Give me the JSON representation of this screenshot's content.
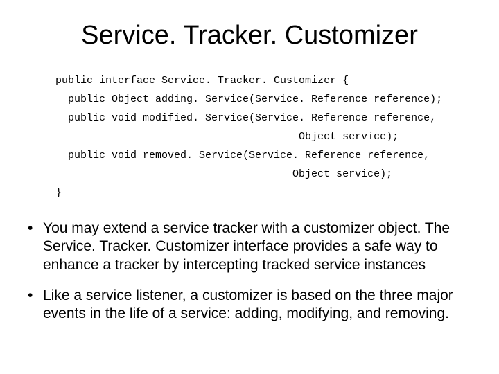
{
  "title": "Service. Tracker. Customizer",
  "code": {
    "l1": "public interface Service. Tracker. Customizer {",
    "l2": "  public Object adding. Service(Service. Reference reference);",
    "l3": "  public void modified. Service(Service. Reference reference,",
    "l4": "                                       Object service);",
    "l5": "  public void removed. Service(Service. Reference reference,",
    "l6": "                                      Object service);",
    "l7": "}"
  },
  "bullets": {
    "b1": "You may extend a service tracker  with a customizer object. The Service. Tracker. Customizer interface provides a safe way to enhance a tracker by intercepting tracked service instances",
    "b2": "Like a service listener, a customizer is based on the three major events in the life of a service: adding, modifying, and removing."
  },
  "dot": "•"
}
